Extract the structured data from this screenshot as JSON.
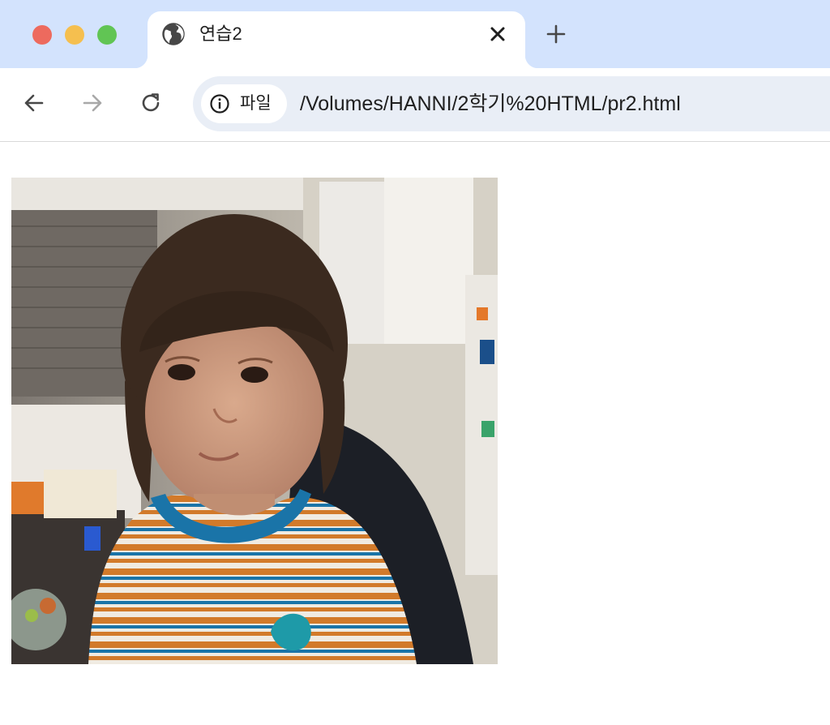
{
  "browser": {
    "tab": {
      "title": "연습2",
      "icon": "globe-icon"
    },
    "toolbar": {
      "back_icon": "arrow-left-icon",
      "forward_icon": "arrow-right-icon",
      "reload_icon": "reload-icon",
      "site_info_label": "파일",
      "url": "/Volumes/HANNI/2학기%20HTML/pr2.html"
    },
    "colors": {
      "tabstrip": "#d3e3fd",
      "omnibox": "#e9eef6",
      "close_red": "#ed6a5e",
      "minimize_yellow": "#f5bf4f",
      "zoom_green": "#61c554"
    }
  },
  "page": {
    "image": {
      "description_icon": "photo-child-striped-shirt"
    }
  }
}
